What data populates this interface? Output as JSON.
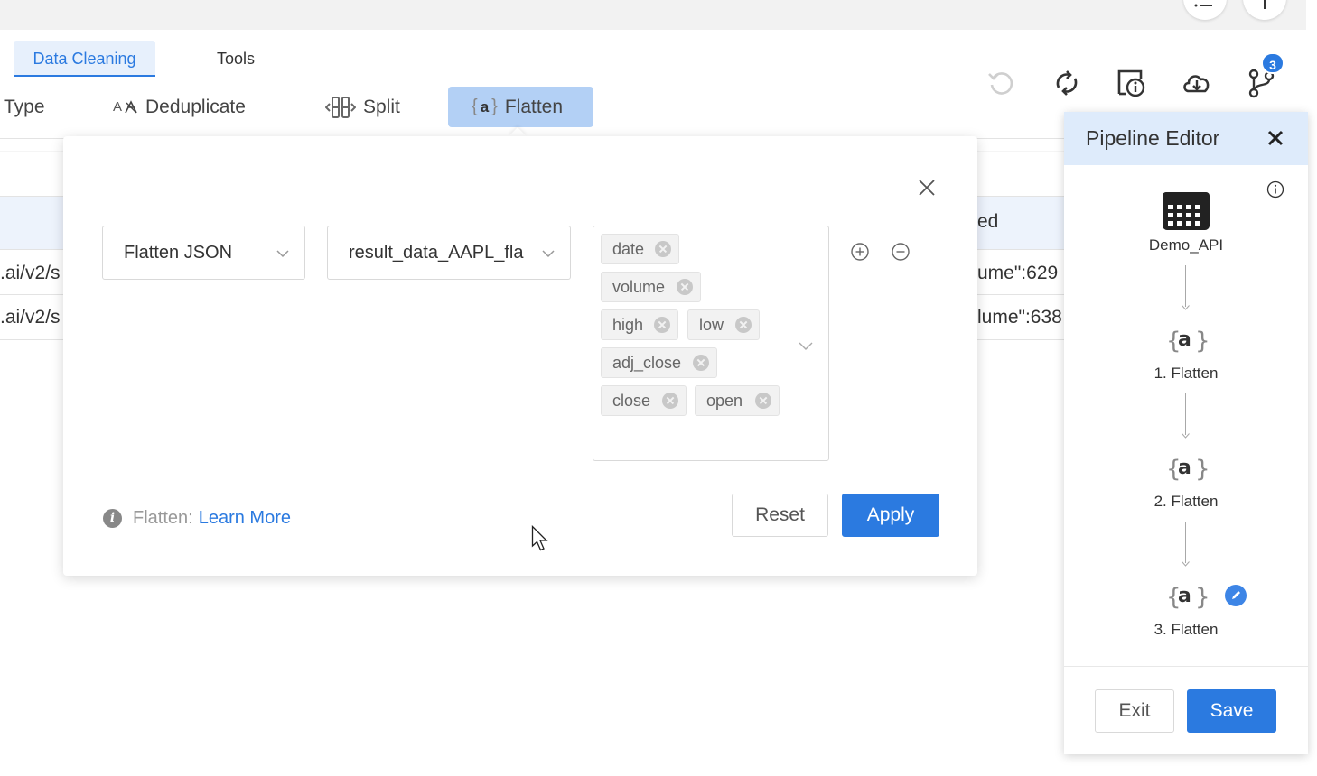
{
  "colors": {
    "accent": "#2b7ae0",
    "active_tab_bg": "#e7f0fc",
    "active_tool_bg": "#b3d0f5",
    "panel_header_bg": "#deebfb"
  },
  "tabs": [
    {
      "label": "Data Cleaning",
      "active": true
    },
    {
      "label": "Tools",
      "active": false
    }
  ],
  "toolbar": {
    "type_label": "Type",
    "dedup_label": "Deduplicate",
    "dedup_icon": "A",
    "split_label": "Split",
    "flatten_label": "Flatten",
    "flatten_icon": "a"
  },
  "grid": {
    "left_cells": [
      ".ai/v2/s",
      ".ai/v2/s"
    ],
    "right_header": "ed",
    "right_cells": [
      "ume\":629",
      "lume\":638"
    ]
  },
  "flatten_form": {
    "operation_value": "Flatten JSON",
    "column_value": "result_data_AAPL_fla",
    "fields": [
      "date",
      "volume",
      "high",
      "low",
      "adj_close",
      "close",
      "open"
    ],
    "info_label": "Flatten:",
    "learn_more": "Learn More",
    "reset_label": "Reset",
    "apply_label": "Apply"
  },
  "right_toolbar": {
    "icons": [
      "undo-icon",
      "refresh-icon",
      "report-info-icon",
      "cloud-download-icon",
      "pipeline-branch-icon"
    ],
    "badge_count": "3"
  },
  "pipeline_editor": {
    "title": "Pipeline Editor",
    "source": {
      "label": "Demo_API",
      "icon": "table-grid-icon"
    },
    "steps": [
      {
        "label": "1. Flatten",
        "icon": "a",
        "editing": false
      },
      {
        "label": "2. Flatten",
        "icon": "a",
        "editing": false
      },
      {
        "label": "3. Flatten",
        "icon": "a",
        "editing": true
      }
    ],
    "exit_label": "Exit",
    "save_label": "Save"
  }
}
